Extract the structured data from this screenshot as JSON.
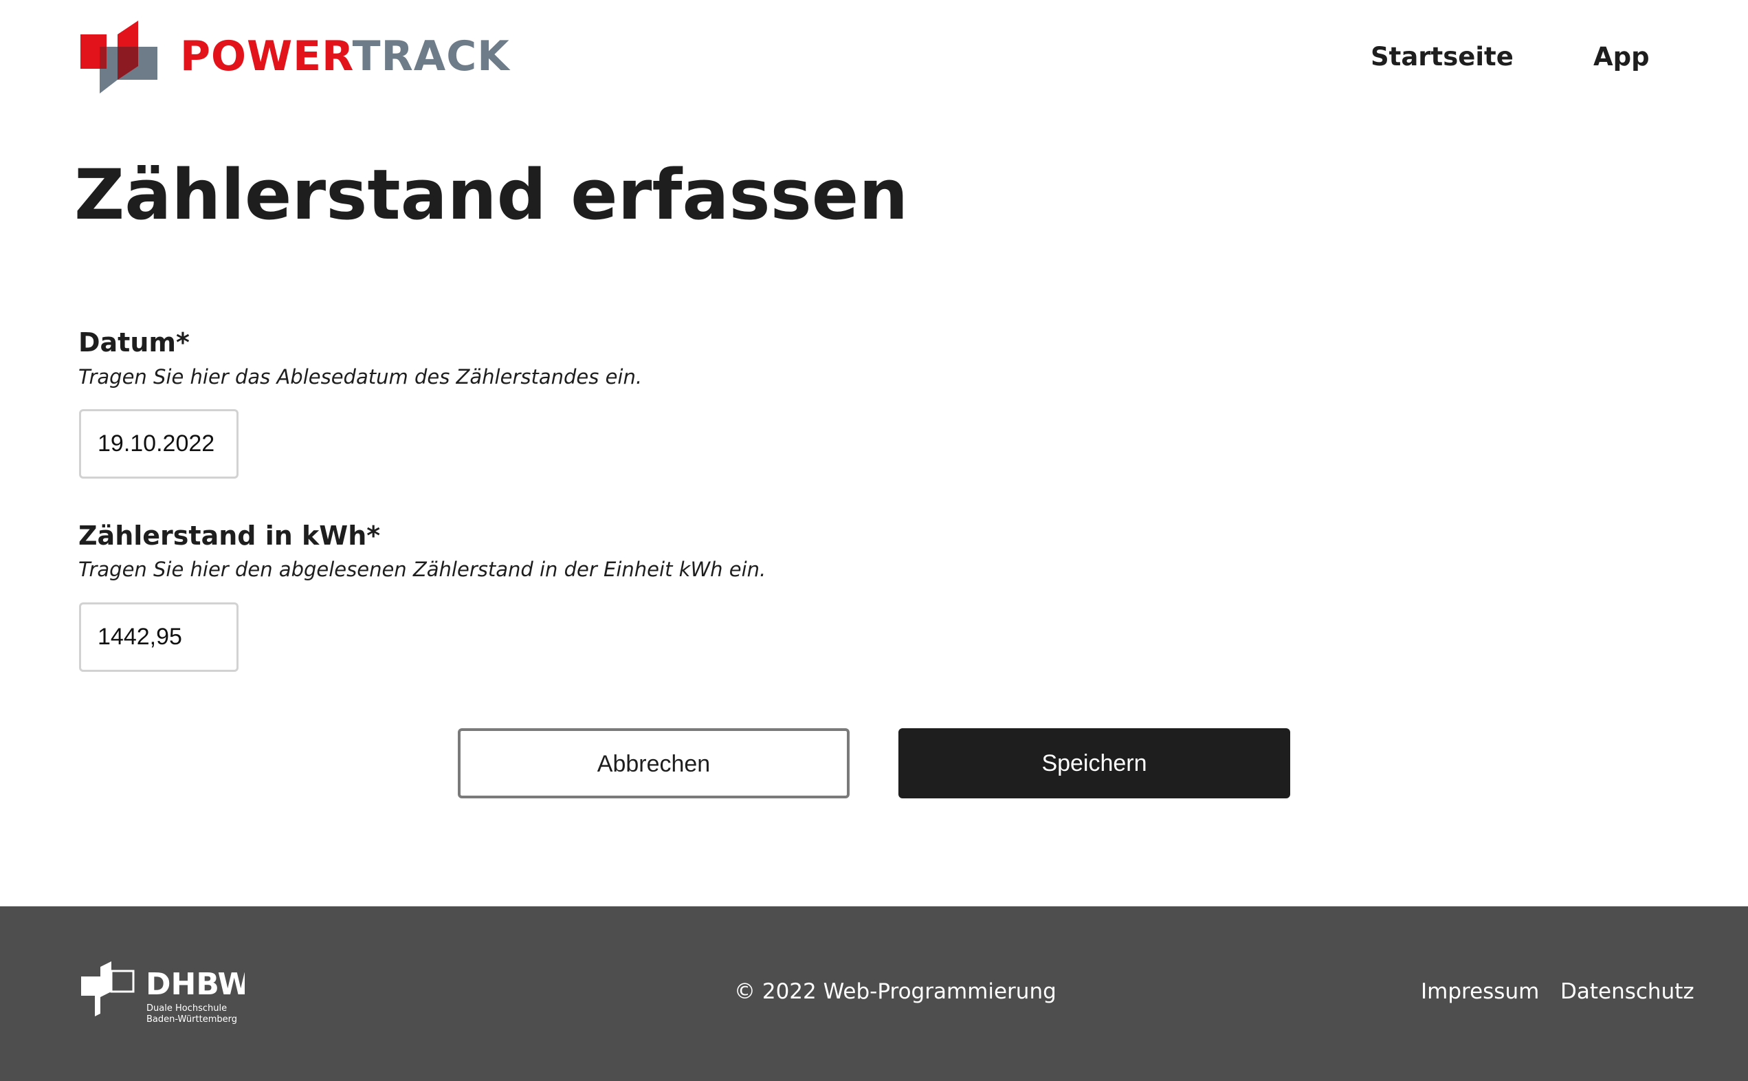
{
  "header": {
    "brand_part1": "POWER",
    "brand_part2": "TRACK",
    "nav": {
      "home": "Startseite",
      "app": "App"
    }
  },
  "main": {
    "title": "Zählerstand erfassen",
    "fields": [
      {
        "label": "Datum*",
        "hint": "Tragen Sie hier das Ablesedatum des Zählerstandes ein.",
        "value": "19.10.2022"
      },
      {
        "label": "Zählerstand in kWh*",
        "hint": "Tragen Sie hier den abgelesenen Zählerstand in der Einheit kWh ein.",
        "value": "1442,95"
      }
    ],
    "buttons": {
      "cancel": "Abbrechen",
      "save": "Speichern"
    }
  },
  "footer": {
    "logo_text": "DHBW",
    "logo_subtitle_1": "Duale Hochschule",
    "logo_subtitle_2": "Baden-Württemberg",
    "copyright": "© 2022 Web-Programmierung",
    "links": {
      "impressum": "Impressum",
      "datenschutz": "Datenschutz"
    }
  },
  "colors": {
    "brand_red": "#e3131b",
    "brand_grey": "#6e7c89",
    "dark": "#1e1e1e",
    "footer_bg": "#4e4e4e"
  },
  "icons": {
    "brand_logo": "powertrack-logo-icon",
    "footer_logo": "dhbw-logo-icon"
  }
}
